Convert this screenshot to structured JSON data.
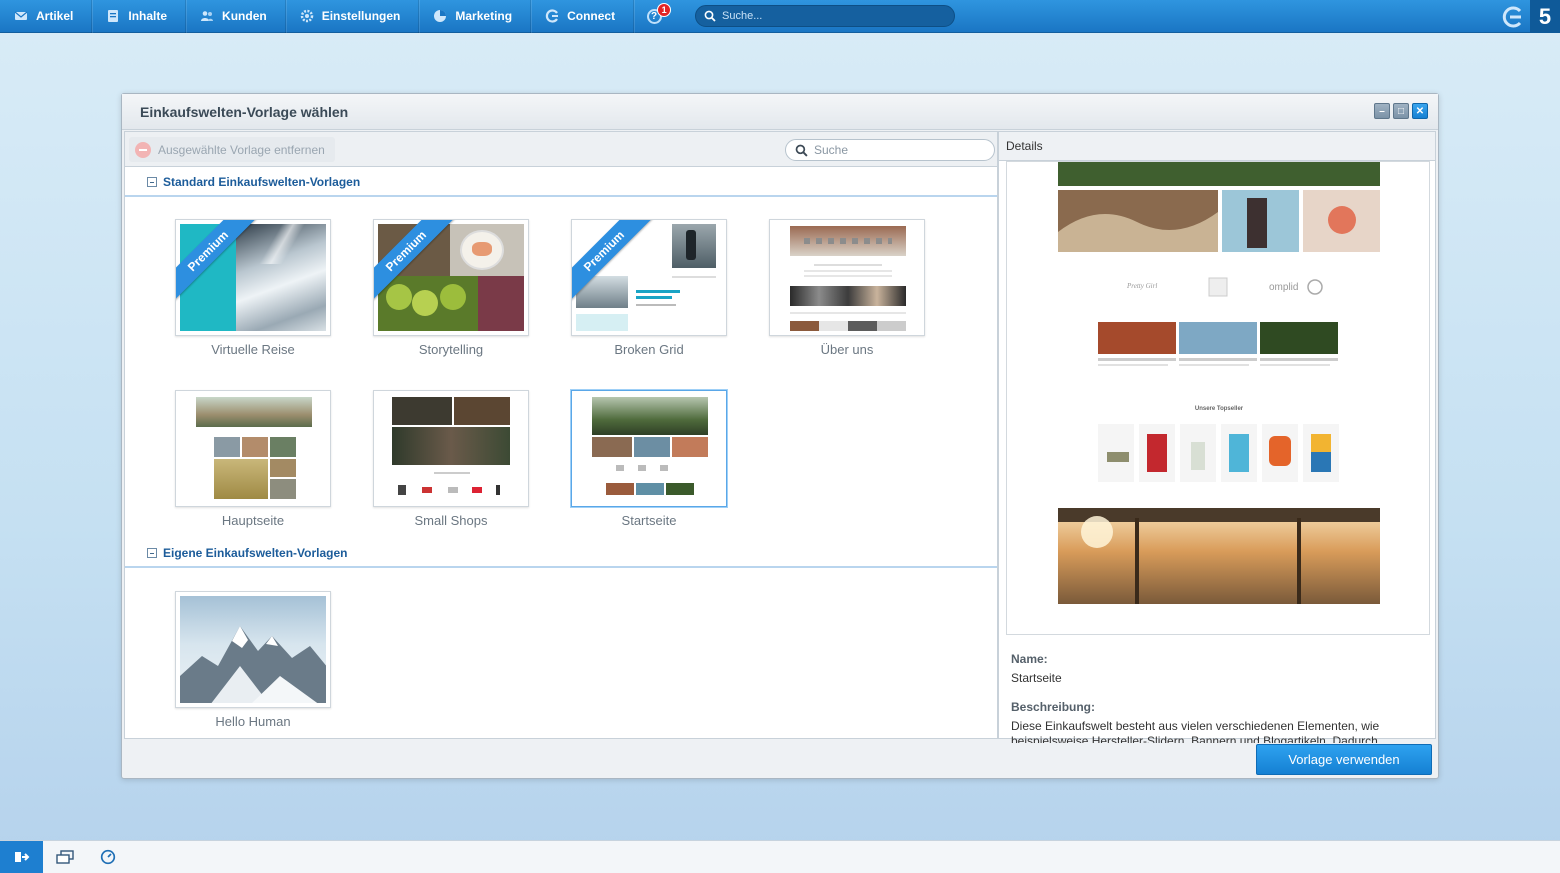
{
  "topbar": {
    "nav": [
      {
        "label": "Artikel",
        "icon": "mail-icon"
      },
      {
        "label": "Inhalte",
        "icon": "document-icon"
      },
      {
        "label": "Kunden",
        "icon": "users-icon"
      },
      {
        "label": "Einstellungen",
        "icon": "gear-icon"
      },
      {
        "label": "Marketing",
        "icon": "pie-chart-icon"
      },
      {
        "label": "Connect",
        "icon": "connect-icon"
      }
    ],
    "help_badge": "1",
    "search_placeholder": "Suche..."
  },
  "window": {
    "title": "Einkaufswelten-Vorlage wählen",
    "toolbar": {
      "remove_label": "Ausgewählte Vorlage entfernen",
      "search_placeholder": "Suche"
    },
    "groups": [
      {
        "title": "Standard Einkaufswelten-Vorlagen",
        "templates": [
          {
            "name": "Virtuelle Reise",
            "premium": true
          },
          {
            "name": "Storytelling",
            "premium": true
          },
          {
            "name": "Broken Grid",
            "premium": true
          },
          {
            "name": "Über uns",
            "premium": false
          },
          {
            "name": "Hauptseite",
            "premium": false
          },
          {
            "name": "Small Shops",
            "premium": false
          },
          {
            "name": "Startseite",
            "premium": false,
            "selected": true
          }
        ]
      },
      {
        "title": "Eigene Einkaufswelten-Vorlagen",
        "templates": [
          {
            "name": "Hello Human",
            "premium": false
          }
        ]
      }
    ],
    "ribbon_label": "Premium",
    "details": {
      "header": "Details",
      "preview_texts": {
        "logo_1": "Pretty Girl",
        "logo_2": "omplid",
        "section_title": "Unsere Topseller"
      },
      "name_label": "Name:",
      "name_value": "Startseite",
      "description_label": "Beschreibung:",
      "description_value": "Diese Einkaufswelt besteht aus vielen verschiedenen Elementen, wie beispielsweise Hersteller-Slidern, Bannern und Blogartikeln. Dadurch"
    },
    "use_button": "Vorlage verwenden"
  },
  "colors": {
    "topbar": "#1f80cc",
    "accent": "#1a86d8",
    "group_title": "#1c5c9a"
  }
}
